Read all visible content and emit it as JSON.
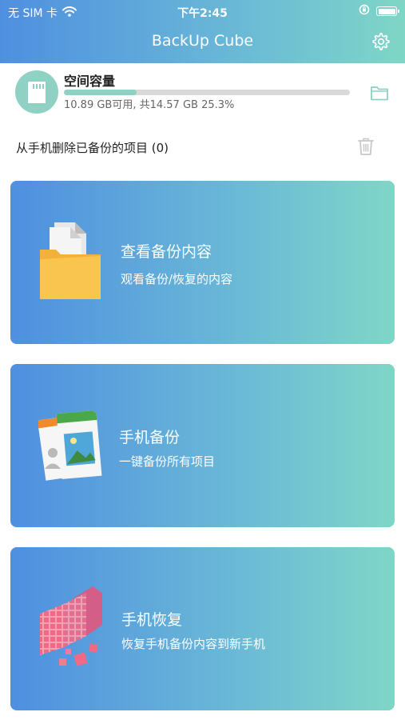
{
  "status_bar": {
    "carrier": "无 SIM 卡",
    "time": "下午2:45"
  },
  "header": {
    "title": "BackUp Cube"
  },
  "storage": {
    "label": "空间容量",
    "detail": "10.89 GB可用, 共14.57 GB 25.3%",
    "used_fraction": 0.253,
    "bar_color": "#8fd1c2"
  },
  "delete_row": {
    "label": "从手机删除已备份的项目 (0)"
  },
  "cards": [
    {
      "title": "查看备份内容",
      "subtitle": "观看备份/恢复的内容",
      "icon": "folder-icon"
    },
    {
      "title": "手机备份",
      "subtitle": "一键备份所有项目",
      "icon": "photo-contacts-icon"
    },
    {
      "title": "手机恢复",
      "subtitle": "恢复手机备份内容到新手机",
      "icon": "cubes-icon"
    }
  ],
  "colors": {
    "gradient_start": "#4f8fe0",
    "gradient_end": "#7fd6c6",
    "accent": "#8fd1c2"
  }
}
